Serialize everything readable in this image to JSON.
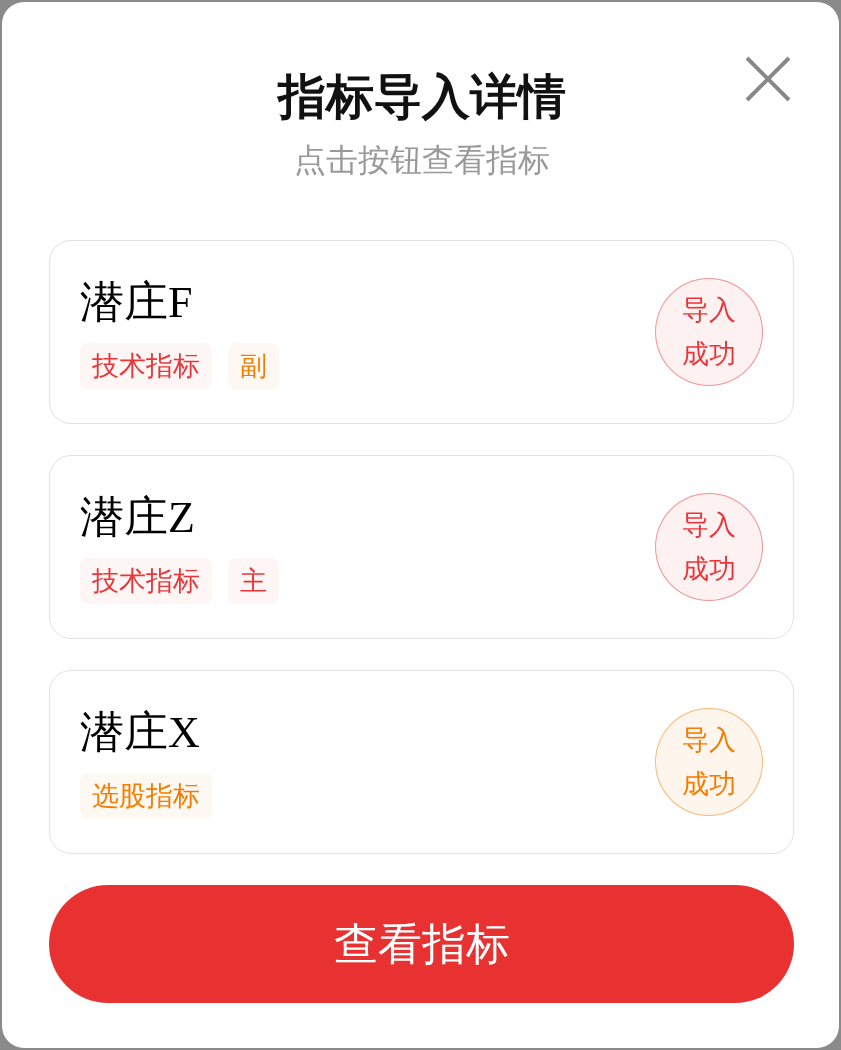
{
  "dialog": {
    "title": "指标导入详情",
    "subtitle": "点击按钮查看指标"
  },
  "items": [
    {
      "name": "潜庄F",
      "tags": [
        {
          "label": "技术指标",
          "color": "#e8373a"
        },
        {
          "label": "副",
          "color": "#f57c00"
        }
      ],
      "status": {
        "label": "导入成功",
        "color": "#e8373a"
      }
    },
    {
      "name": "潜庄Z",
      "tags": [
        {
          "label": "技术指标",
          "color": "#e8373a"
        },
        {
          "label": "主",
          "color": "#e8373a"
        }
      ],
      "status": {
        "label": "导入成功",
        "color": "#e8373a"
      }
    },
    {
      "name": "潜庄X",
      "tags": [
        {
          "label": "选股指标",
          "color": "#f57c00"
        }
      ],
      "status": {
        "label": "导入成功",
        "color": "#f57c00"
      }
    }
  ],
  "button": {
    "label": "查看指标"
  }
}
